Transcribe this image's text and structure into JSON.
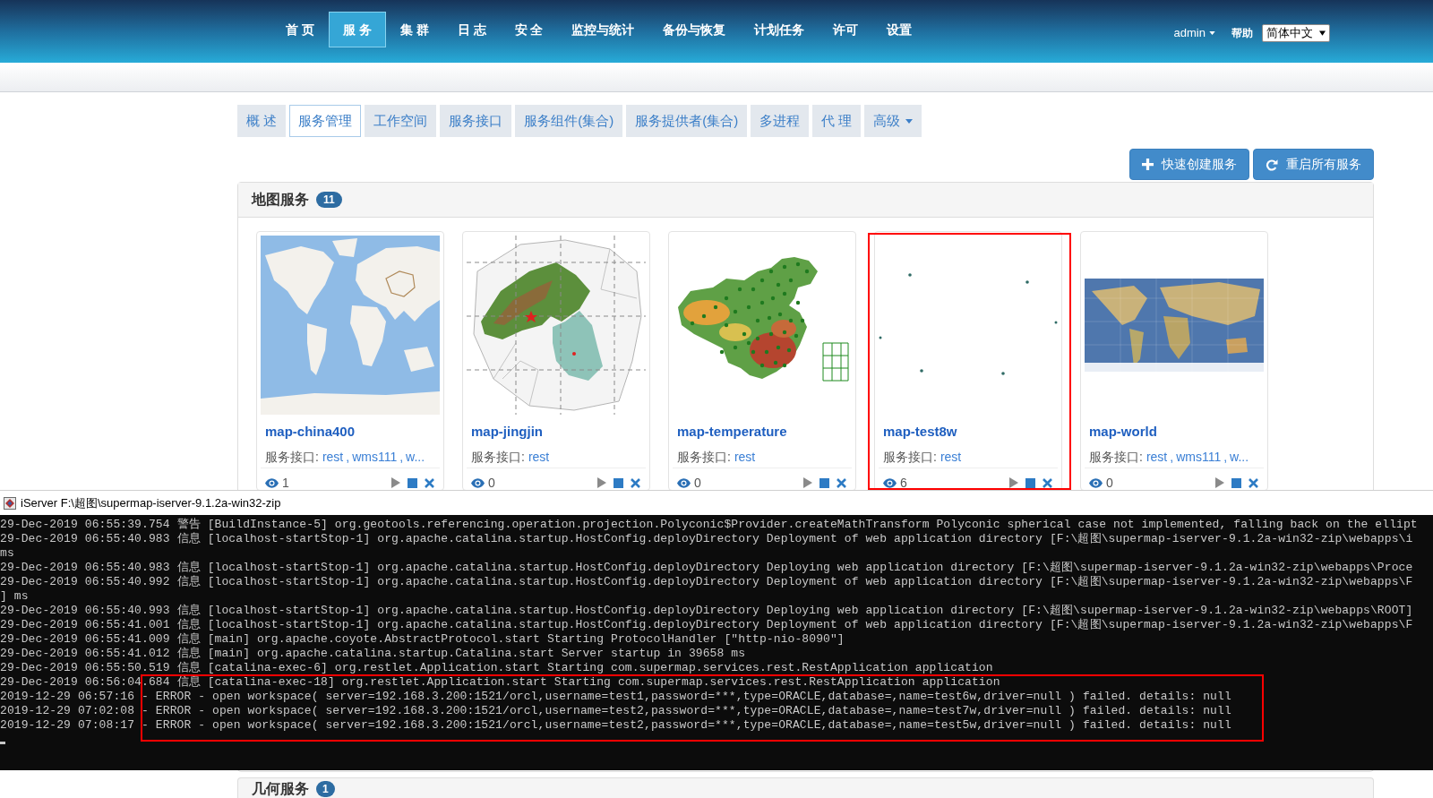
{
  "nav": {
    "items": [
      {
        "label": "首 页",
        "selected": false
      },
      {
        "label": "服 务",
        "selected": true
      },
      {
        "label": "集 群",
        "selected": false
      },
      {
        "label": "日 志",
        "selected": false
      },
      {
        "label": "安 全",
        "selected": false
      },
      {
        "label": "监控与统计",
        "selected": false
      },
      {
        "label": "备份与恢复",
        "selected": false
      },
      {
        "label": "计划任务",
        "selected": false
      },
      {
        "label": "许可",
        "selected": false
      },
      {
        "label": "设置",
        "selected": false
      }
    ],
    "user": "admin",
    "help": "帮助",
    "language": "简体中文"
  },
  "tabs": [
    {
      "label": "概 述",
      "selected": false,
      "dropdown": false
    },
    {
      "label": "服务管理",
      "selected": true,
      "dropdown": false
    },
    {
      "label": "工作空间",
      "selected": false,
      "dropdown": false
    },
    {
      "label": "服务接口",
      "selected": false,
      "dropdown": false
    },
    {
      "label": "服务组件(集合)",
      "selected": false,
      "dropdown": false
    },
    {
      "label": "服务提供者(集合)",
      "selected": false,
      "dropdown": false
    },
    {
      "label": "多进程",
      "selected": false,
      "dropdown": false
    },
    {
      "label": "代 理",
      "selected": false,
      "dropdown": false
    },
    {
      "label": "高级",
      "selected": false,
      "dropdown": true
    }
  ],
  "actions": [
    {
      "kind": "create",
      "label": "快速创建服务"
    },
    {
      "kind": "restart",
      "label": "重启所有服务"
    }
  ],
  "map_services": {
    "title": "地图服务",
    "count": "11",
    "separator": ",",
    "cards": [
      {
        "name": "map-china400",
        "thumbnail": {
          "kind": "world-light"
        },
        "interface_label": "服务接口:",
        "interfaces": [
          "rest",
          "wms111",
          "w..."
        ],
        "views": "1",
        "highlighted": false
      },
      {
        "name": "map-jingjin",
        "thumbnail": {
          "kind": "region"
        },
        "interface_label": "服务接口:",
        "interfaces": [
          "rest"
        ],
        "views": "0",
        "highlighted": false
      },
      {
        "name": "map-temperature",
        "thumbnail": {
          "kind": "temperature"
        },
        "interface_label": "服务接口:",
        "interfaces": [
          "rest"
        ],
        "views": "0",
        "highlighted": false
      },
      {
        "name": "map-test8w",
        "thumbnail": {
          "kind": "points"
        },
        "interface_label": "服务接口:",
        "interfaces": [
          "rest"
        ],
        "views": "6",
        "highlighted": true
      },
      {
        "name": "map-world",
        "thumbnail": {
          "kind": "world"
        },
        "interface_label": "服务接口:",
        "interfaces": [
          "rest",
          "wms111",
          "w..."
        ],
        "views": "0",
        "highlighted": false
      }
    ]
  },
  "console": {
    "title": "iServer F:\\超图\\supermap-iserver-9.1.2a-win32-zip",
    "lines": [
      {
        "text": "29-Dec-2019 06:55:39.754 警告 [BuildInstance-5] org.geotools.referencing.operation.projection.Polyconic$Provider.createMathTransform Polyconic spherical case not implemented, falling back on the ellipt",
        "highlighted": false
      },
      {
        "text": "29-Dec-2019 06:55:40.983 信息 [localhost-startStop-1] org.apache.catalina.startup.HostConfig.deployDirectory Deployment of web application directory [F:\\超图\\supermap-iserver-9.1.2a-win32-zip\\webapps\\i",
        "highlighted": false
      },
      {
        "text": "ms",
        "highlighted": false
      },
      {
        "text": "29-Dec-2019 06:55:40.983 信息 [localhost-startStop-1] org.apache.catalina.startup.HostConfig.deployDirectory Deploying web application directory [F:\\超图\\supermap-iserver-9.1.2a-win32-zip\\webapps\\Proce",
        "highlighted": false
      },
      {
        "text": "29-Dec-2019 06:55:40.992 信息 [localhost-startStop-1] org.apache.catalina.startup.HostConfig.deployDirectory Deployment of web application directory [F:\\超图\\supermap-iserver-9.1.2a-win32-zip\\webapps\\F",
        "highlighted": false
      },
      {
        "text": "] ms",
        "highlighted": false
      },
      {
        "text": "29-Dec-2019 06:55:40.993 信息 [localhost-startStop-1] org.apache.catalina.startup.HostConfig.deployDirectory Deploying web application directory [F:\\超图\\supermap-iserver-9.1.2a-win32-zip\\webapps\\ROOT]",
        "highlighted": false
      },
      {
        "text": "29-Dec-2019 06:55:41.001 信息 [localhost-startStop-1] org.apache.catalina.startup.HostConfig.deployDirectory Deployment of web application directory [F:\\超图\\supermap-iserver-9.1.2a-win32-zip\\webapps\\F",
        "highlighted": false
      },
      {
        "text": "29-Dec-2019 06:55:41.009 信息 [main] org.apache.coyote.AbstractProtocol.start Starting ProtocolHandler [\"http-nio-8090\"]",
        "highlighted": false
      },
      {
        "text": "29-Dec-2019 06:55:41.012 信息 [main] org.apache.catalina.startup.Catalina.start Server startup in 39658 ms",
        "highlighted": false
      },
      {
        "text": "29-Dec-2019 06:55:50.519 信息 [catalina-exec-6] org.restlet.Application.start Starting com.supermap.services.rest.RestApplication application",
        "highlighted": false
      },
      {
        "text": "29-Dec-2019 06:56:04.684 信息 [catalina-exec-18] org.restlet.Application.start Starting com.supermap.services.rest.RestApplication application",
        "highlighted": true
      },
      {
        "text": "2019-12-29 06:57:16 - ERROR - open workspace( server=192.168.3.200:1521/orcl,username=test1,password=***,type=ORACLE,database=,name=test6w,driver=null ) failed. details: null",
        "highlighted": true
      },
      {
        "text": "2019-12-29 07:02:08 - ERROR - open workspace( server=192.168.3.200:1521/orcl,username=test2,password=***,type=ORACLE,database=,name=test7w,driver=null ) failed. details: null",
        "highlighted": true
      },
      {
        "text": "2019-12-29 07:08:17 - ERROR - open workspace( server=192.168.3.200:1521/orcl,username=test2,password=***,type=ORACLE,database=,name=test5w,driver=null ) failed. details: null",
        "highlighted": true
      }
    ]
  },
  "geometry_services": {
    "title": "几何服务",
    "count": "1"
  }
}
